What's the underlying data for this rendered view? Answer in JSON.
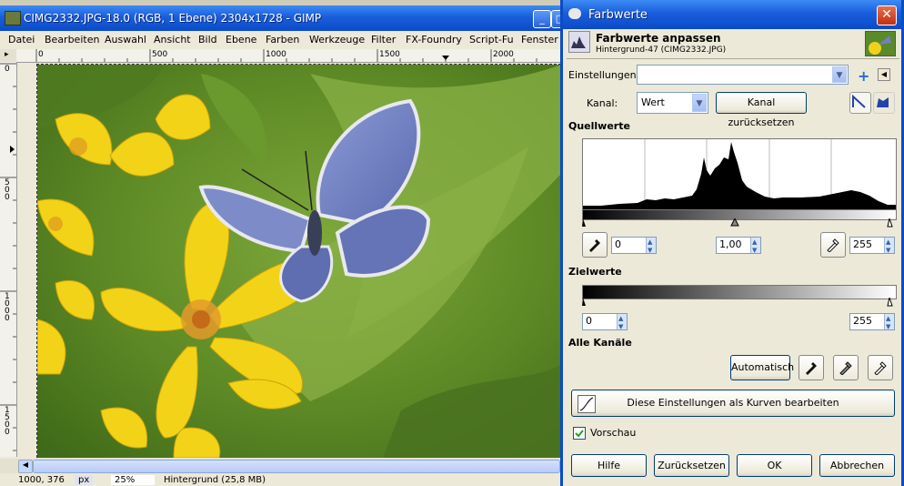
{
  "gimp_window": {
    "title": "CIMG2332.JPG-18.0 (RGB, 1 Ebene) 2304x1728 - GIMP",
    "menu": [
      "Datei",
      "Bearbeiten",
      "Auswahl",
      "Ansicht",
      "Bild",
      "Ebene",
      "Farben",
      "Werkzeuge",
      "Filter",
      "FX-Foundry",
      "Script-Fu",
      "Fenster"
    ],
    "ruler_top_labels": [
      "0",
      "500",
      "1000",
      "1500",
      "2000"
    ],
    "ruler_left_labels": [
      "0",
      "500",
      "1000",
      "1500"
    ],
    "status": {
      "coords": "1000, 376",
      "unit": "px",
      "zoom": "25%",
      "layer_info": "Hintergrund (25,8 MB)"
    }
  },
  "dialog": {
    "title": "Farbwerte",
    "header_title": "Farbwerte anpassen",
    "header_subtitle": "Hintergrund-47 (CIMG2332.JPG)",
    "einstellungen_label": "Einstellungen:",
    "einstellungen_value": "",
    "kanal_label": "Kanal:",
    "kanal_value": "Wert",
    "kanal_reset": "Kanal zurücksetzen",
    "quellwerte": "Quellwerte",
    "input_low": "0",
    "input_gamma": "1,00",
    "input_high": "255",
    "zielwerte": "Zielwerte",
    "output_low": "0",
    "output_high": "255",
    "alle_kanaele": "Alle Kanäle",
    "automatisch": "Automatisch",
    "curves_button": "Diese Einstellungen als Kurven bearbeiten",
    "vorschau": "Vorschau",
    "buttons": {
      "hilfe": "Hilfe",
      "reset": "Zurücksetzen",
      "ok": "OK",
      "cancel": "Abbrechen"
    }
  },
  "colors": {
    "titlebar_blue": "#0a4bc7",
    "dialog_bg": "#ece9d8",
    "leaf_green": "#6e9a2e",
    "flower_yellow": "#f0d21e",
    "butterfly_blue": "#6e80c0"
  }
}
